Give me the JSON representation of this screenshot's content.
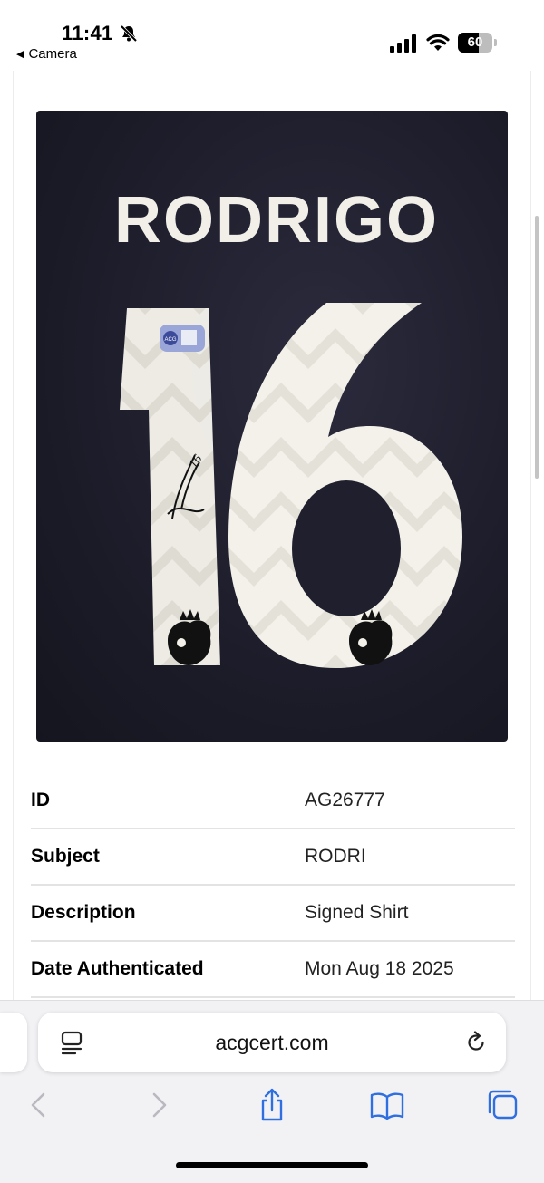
{
  "status_bar": {
    "time": "11:41",
    "back_app": "Camera",
    "battery_level": "60",
    "icons": [
      "bell-slash-icon",
      "cellular-signal-icon",
      "wifi-icon",
      "battery-icon"
    ]
  },
  "photo": {
    "name_print": "RODRIGO",
    "number_print": "16",
    "signature_number": "16",
    "hologram_text": "ACG",
    "colors": {
      "shirt": "#1d1d2b",
      "print": "#f1efe8"
    }
  },
  "details": {
    "rows": [
      {
        "key": "ID",
        "value": "AG26777"
      },
      {
        "key": "Subject",
        "value": "RODRI"
      },
      {
        "key": "Description",
        "value": "Signed Shirt"
      },
      {
        "key": "Date Authenticated",
        "value": "Mon Aug 18 2025"
      }
    ]
  },
  "browser": {
    "url": "acgcert.com",
    "icons": [
      "reader-mode-icon",
      "reload-icon",
      "back-chevron-icon",
      "forward-chevron-icon",
      "share-icon",
      "bookmarks-icon",
      "tabs-icon"
    ]
  }
}
